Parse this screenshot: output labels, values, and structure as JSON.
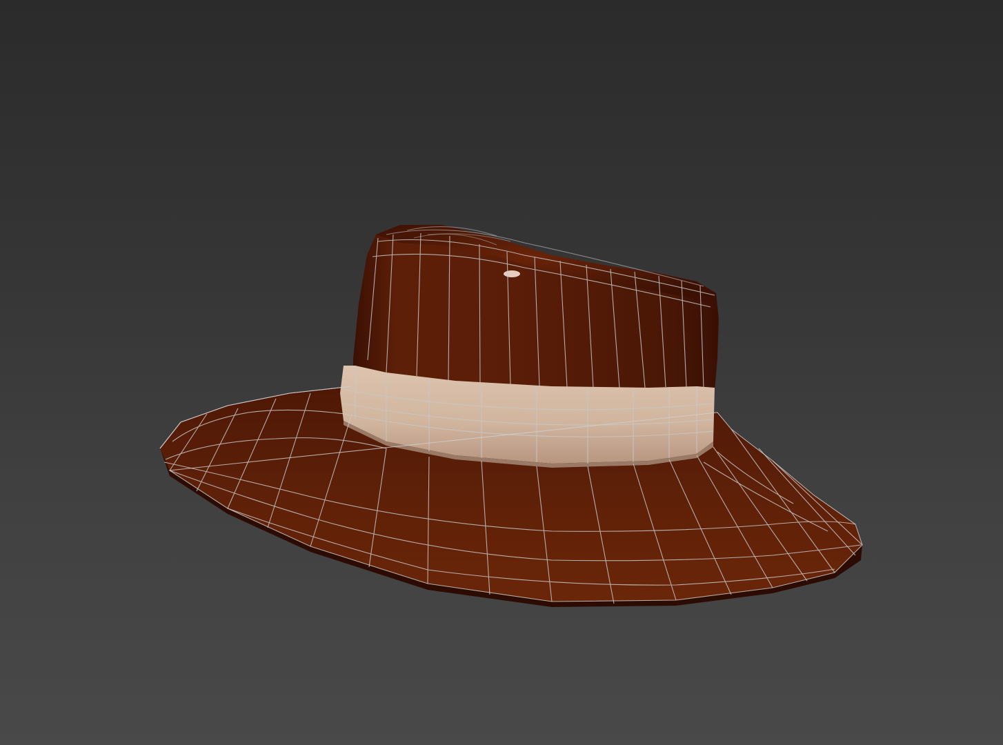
{
  "viewport": {
    "background_top": "#2b2b2b",
    "background_bottom": "#494949"
  },
  "model": {
    "name": "hat",
    "display_mode": "shaded-with-wireframe",
    "colors": {
      "hat_body": "#5a1d08",
      "hat_dark": "#3a1004",
      "band": "#d2b6a0",
      "band_shadow": "#b89680",
      "wire": "#c9c9c9"
    }
  }
}
